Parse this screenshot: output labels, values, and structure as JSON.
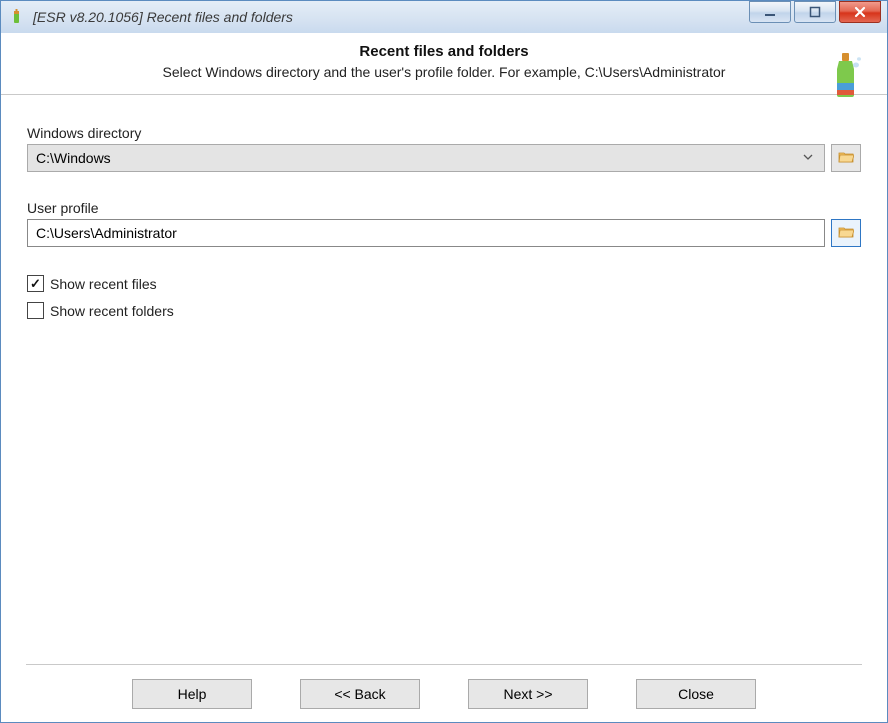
{
  "titlebar": {
    "text": "[ESR v8.20.1056]  Recent files and folders"
  },
  "header": {
    "title": "Recent files and folders",
    "subtitle": "Select Windows directory and the user's profile folder. For example, C:\\Users\\Administrator"
  },
  "fields": {
    "windows_dir": {
      "label": "Windows directory",
      "value": "C:\\Windows"
    },
    "user_profile": {
      "label": "User profile",
      "value": "C:\\Users\\Administrator"
    }
  },
  "checkboxes": {
    "show_files": {
      "label": "Show recent files",
      "checked": true
    },
    "show_folders": {
      "label": "Show recent folders",
      "checked": false
    }
  },
  "buttons": {
    "help": "Help",
    "back": "<< Back",
    "next": "Next >>",
    "close": "Close"
  }
}
